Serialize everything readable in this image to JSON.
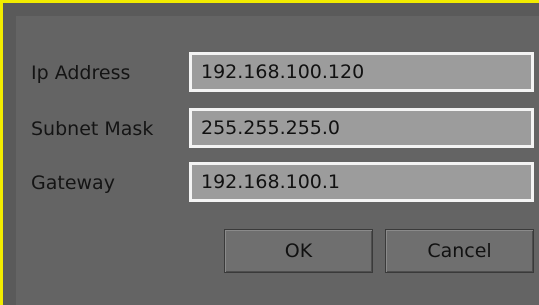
{
  "form": {
    "ip": {
      "label": "Ip Address",
      "value": "192.168.100.120"
    },
    "subnet": {
      "label": "Subnet Mask",
      "value": "255.255.255.0"
    },
    "gateway": {
      "label": "Gateway",
      "value": "192.168.100.1"
    }
  },
  "buttons": {
    "ok": "OK",
    "cancel": "Cancel"
  },
  "colors": {
    "frame_border": "#f2ec00",
    "panel_background": "#646464",
    "field_background": "#9c9c9c",
    "field_border": "#f4f4f4"
  }
}
